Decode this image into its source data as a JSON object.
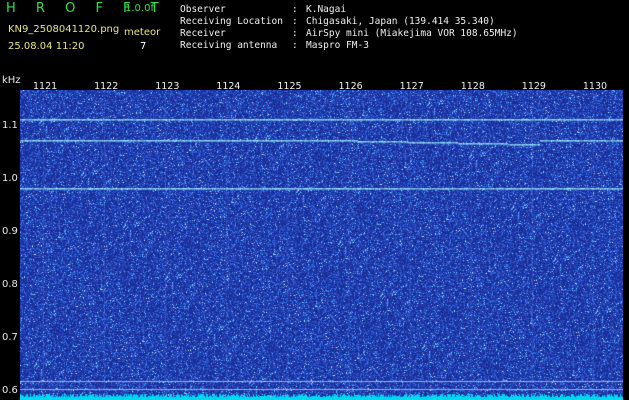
{
  "header": {
    "app_title": "H R O F F T",
    "version": "1.0.0f",
    "filename": "KN9_2508041120.png",
    "datetime": "25.08.04 11:20",
    "meteor_label": "meteor",
    "meteor_count": "7",
    "info": [
      {
        "label": "Observer",
        "value": "K.Nagai"
      },
      {
        "label": "Receiving Location",
        "value": "Chigasaki, Japan (139.414 35.340)"
      },
      {
        "label": "Receiver",
        "value": "AirSpy mini (Miakejima VOR 108.65MHz)"
      },
      {
        "label": "Receiving antenna",
        "value": "Maspro FM-3"
      }
    ]
  },
  "chart_data": {
    "type": "heatmap",
    "ylabel": "kHz",
    "x_ticks": [
      "1121",
      "1122",
      "1123",
      "1124",
      "1125",
      "1126",
      "1127",
      "1128",
      "1129",
      "1130"
    ],
    "y_ticks": [
      "1.1",
      "1.0",
      "0.9",
      "0.8",
      "0.7",
      "0.6"
    ],
    "ylim": [
      0.585,
      1.17
    ],
    "signal_lines_khz": [
      1.115,
      1.075,
      0.985
    ],
    "reference_lines_khz": [
      0.62,
      0.605
    ],
    "colors": {
      "background": "#1b2f9a",
      "noise": "#3f7cff",
      "signal": "#9ef0ff",
      "baseline": "#00d8f0"
    }
  }
}
